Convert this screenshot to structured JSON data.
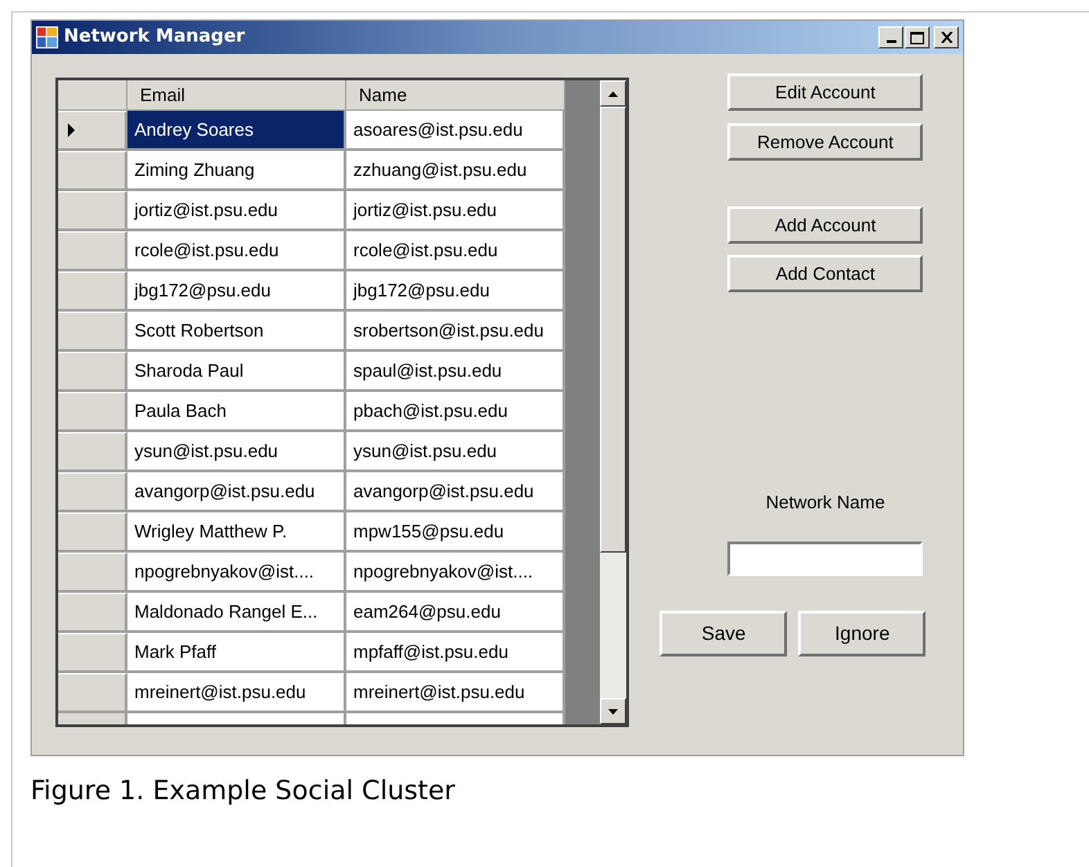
{
  "window": {
    "title": "Network Manager"
  },
  "table": {
    "columns": [
      "Email",
      "Name"
    ],
    "rows": [
      {
        "cells": [
          "Andrey Soares",
          "asoares@ist.psu.edu"
        ],
        "selected": true
      },
      {
        "cells": [
          "Ziming Zhuang",
          "zzhuang@ist.psu.edu"
        ],
        "selected": false
      },
      {
        "cells": [
          "jortiz@ist.psu.edu",
          "jortiz@ist.psu.edu"
        ],
        "selected": false
      },
      {
        "cells": [
          "rcole@ist.psu.edu",
          "rcole@ist.psu.edu"
        ],
        "selected": false
      },
      {
        "cells": [
          "jbg172@psu.edu",
          "jbg172@psu.edu"
        ],
        "selected": false
      },
      {
        "cells": [
          "Scott Robertson",
          "srobertson@ist.psu.edu"
        ],
        "selected": false
      },
      {
        "cells": [
          "Sharoda Paul",
          "spaul@ist.psu.edu"
        ],
        "selected": false
      },
      {
        "cells": [
          "Paula Bach",
          "pbach@ist.psu.edu"
        ],
        "selected": false
      },
      {
        "cells": [
          "ysun@ist.psu.edu",
          "ysun@ist.psu.edu"
        ],
        "selected": false
      },
      {
        "cells": [
          "avangorp@ist.psu.edu",
          "avangorp@ist.psu.edu"
        ],
        "selected": false
      },
      {
        "cells": [
          "Wrigley Matthew P.",
          "mpw155@psu.edu"
        ],
        "selected": false
      },
      {
        "cells": [
          "npogrebnyakov@ist....",
          "npogrebnyakov@ist...."
        ],
        "selected": false
      },
      {
        "cells": [
          "Maldonado Rangel E...",
          "eam264@psu.edu"
        ],
        "selected": false
      },
      {
        "cells": [
          "Mark Pfaff",
          "mpfaff@ist.psu.edu"
        ],
        "selected": false
      },
      {
        "cells": [
          "mreinert@ist.psu.edu",
          "mreinert@ist.psu.edu"
        ],
        "selected": false
      }
    ]
  },
  "actions": [
    "Edit Account",
    "Remove Account",
    "Add Account",
    "Add Contact"
  ],
  "network_name": {
    "label": "Network Name"
  },
  "buttons": [
    "Save",
    "Ignore"
  ],
  "caption": "Figure 1. Example Social Cluster"
}
